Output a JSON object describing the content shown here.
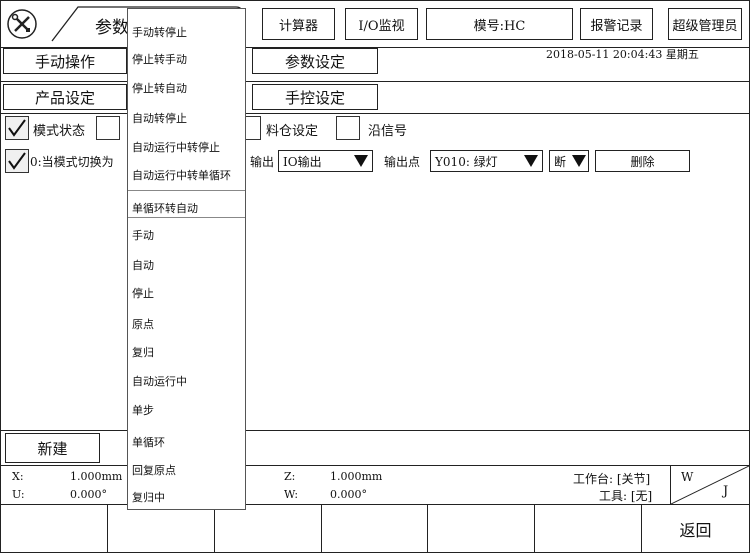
{
  "header": {
    "page_tab": "参数",
    "calculator": "计算器",
    "io_monitor": "I/O监视",
    "mold_no": "模号:HC",
    "alarm_log": "报警记录",
    "user": "超级管理员",
    "datetime": "2018-05-11  20:04:43 星期五"
  },
  "tabs": {
    "manual_op": "手动操作",
    "param_set": "参数设定",
    "product_set": "产品设定",
    "hand_control": "手控设定"
  },
  "options": {
    "mode_state": "模式状态",
    "silo_set": "料仓设定",
    "edge_signal": "沿信号"
  },
  "rule_row": {
    "condition": "0:当模式切换为",
    "output_label": "输出",
    "output_value": "IO输出",
    "point_label": "输出点",
    "point_value": "Y010: 绿灯",
    "state_value": "断",
    "delete": "删除"
  },
  "footer": {
    "new_button": "新建",
    "return_button": "返回",
    "x_label": "X:",
    "x_value": "1.000mm",
    "u_label": "U:",
    "u_value": "0.000°",
    "z_label": "Z:",
    "z_value": "1.000mm",
    "w_label": "W:",
    "w_value": "0.000°",
    "workbench": "工作台: [关节]",
    "tool": "工具: [无]",
    "corner_w": "W",
    "corner_j": "J"
  },
  "menu": {
    "items": [
      "手动转停止",
      "停止转手动",
      "停止转自动",
      "自动转停止",
      "自动运行中转停止",
      "自动运行中转单循环",
      "单循环转自动",
      "手动",
      "自动",
      "停止",
      "原点",
      "复归",
      "自动运行中",
      "单步",
      "单循环",
      "回复原点",
      "复归中"
    ]
  }
}
